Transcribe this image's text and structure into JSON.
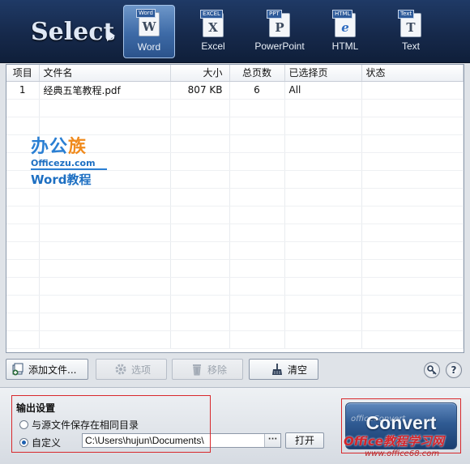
{
  "header": {
    "select_label": "Select",
    "formats": [
      {
        "tag": "Word",
        "glyph": "W",
        "label": "Word",
        "active": true
      },
      {
        "tag": "EXCEL",
        "glyph": "X",
        "label": "Excel",
        "active": false
      },
      {
        "tag": "PPT",
        "glyph": "P",
        "label": "PowerPoint",
        "active": false
      },
      {
        "tag": "HTML",
        "glyph": "e",
        "label": "HTML",
        "active": false
      },
      {
        "tag": "Text",
        "glyph": "T",
        "label": "Text",
        "active": false
      }
    ]
  },
  "table": {
    "columns": [
      "项目",
      "文件名",
      "大小",
      "总页数",
      "已选择页",
      "状态"
    ],
    "rows": [
      {
        "index": "1",
        "filename": "经典五笔教程.pdf",
        "size": "807  KB",
        "pages": "6",
        "selected_pages": "All",
        "status": ""
      }
    ]
  },
  "watermark": {
    "logo_line1": "办公族",
    "logo_line2": "Officezu.com",
    "logo_line3": "Word教程"
  },
  "toolbar": {
    "add_files": "添加文件...",
    "options": "选项",
    "remove": "移除",
    "clear": "清空"
  },
  "output": {
    "title": "输出设置",
    "option_same_dir": "与源文件保存在相同目录",
    "option_custom": "自定义",
    "custom_selected": true,
    "path": "C:\\Users\\hujun\\Documents\\",
    "browse": "···",
    "open": "打开"
  },
  "convert": {
    "label": "Convert",
    "ghost": "officeConvert"
  },
  "site_watermark": {
    "text": "Office教程学习网",
    "url": "www.office68.com"
  },
  "colors": {
    "banner": "#16294b",
    "active_tab": "#3d6aa6",
    "highlight_red": "#d8282b"
  }
}
